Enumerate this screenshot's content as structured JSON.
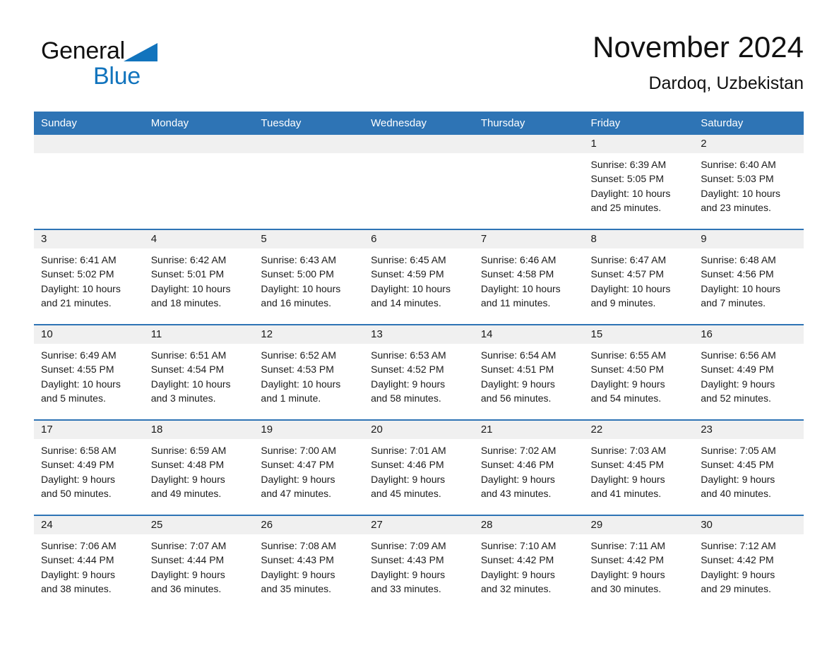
{
  "brand": {
    "name_part1": "General",
    "name_part2": "Blue",
    "triangle_color": "#1274bd",
    "text_color": "#111111"
  },
  "header": {
    "title": "November 2024",
    "subtitle": "Dardoq, Uzbekistan"
  },
  "theme": {
    "header_blue": "#2e74b5",
    "daynum_band": "#f0f0f0",
    "page_background": "#ffffff"
  },
  "weekday_headers": [
    "Sunday",
    "Monday",
    "Tuesday",
    "Wednesday",
    "Thursday",
    "Friday",
    "Saturday"
  ],
  "labels": {
    "sunrise_prefix": "Sunrise:",
    "sunset_prefix": "Sunset:",
    "daylight_prefix": "Daylight:"
  },
  "weeks": [
    [
      {
        "day": "",
        "empty": true
      },
      {
        "day": "",
        "empty": true
      },
      {
        "day": "",
        "empty": true
      },
      {
        "day": "",
        "empty": true
      },
      {
        "day": "",
        "empty": true
      },
      {
        "day": "1",
        "sunrise": "Sunrise: 6:39 AM",
        "sunset": "Sunset: 5:05 PM",
        "daylight_line1": "Daylight: 10 hours",
        "daylight_line2": "and 25 minutes."
      },
      {
        "day": "2",
        "sunrise": "Sunrise: 6:40 AM",
        "sunset": "Sunset: 5:03 PM",
        "daylight_line1": "Daylight: 10 hours",
        "daylight_line2": "and 23 minutes."
      }
    ],
    [
      {
        "day": "3",
        "sunrise": "Sunrise: 6:41 AM",
        "sunset": "Sunset: 5:02 PM",
        "daylight_line1": "Daylight: 10 hours",
        "daylight_line2": "and 21 minutes."
      },
      {
        "day": "4",
        "sunrise": "Sunrise: 6:42 AM",
        "sunset": "Sunset: 5:01 PM",
        "daylight_line1": "Daylight: 10 hours",
        "daylight_line2": "and 18 minutes."
      },
      {
        "day": "5",
        "sunrise": "Sunrise: 6:43 AM",
        "sunset": "Sunset: 5:00 PM",
        "daylight_line1": "Daylight: 10 hours",
        "daylight_line2": "and 16 minutes."
      },
      {
        "day": "6",
        "sunrise": "Sunrise: 6:45 AM",
        "sunset": "Sunset: 4:59 PM",
        "daylight_line1": "Daylight: 10 hours",
        "daylight_line2": "and 14 minutes."
      },
      {
        "day": "7",
        "sunrise": "Sunrise: 6:46 AM",
        "sunset": "Sunset: 4:58 PM",
        "daylight_line1": "Daylight: 10 hours",
        "daylight_line2": "and 11 minutes."
      },
      {
        "day": "8",
        "sunrise": "Sunrise: 6:47 AM",
        "sunset": "Sunset: 4:57 PM",
        "daylight_line1": "Daylight: 10 hours",
        "daylight_line2": "and 9 minutes."
      },
      {
        "day": "9",
        "sunrise": "Sunrise: 6:48 AM",
        "sunset": "Sunset: 4:56 PM",
        "daylight_line1": "Daylight: 10 hours",
        "daylight_line2": "and 7 minutes."
      }
    ],
    [
      {
        "day": "10",
        "sunrise": "Sunrise: 6:49 AM",
        "sunset": "Sunset: 4:55 PM",
        "daylight_line1": "Daylight: 10 hours",
        "daylight_line2": "and 5 minutes."
      },
      {
        "day": "11",
        "sunrise": "Sunrise: 6:51 AM",
        "sunset": "Sunset: 4:54 PM",
        "daylight_line1": "Daylight: 10 hours",
        "daylight_line2": "and 3 minutes."
      },
      {
        "day": "12",
        "sunrise": "Sunrise: 6:52 AM",
        "sunset": "Sunset: 4:53 PM",
        "daylight_line1": "Daylight: 10 hours",
        "daylight_line2": "and 1 minute."
      },
      {
        "day": "13",
        "sunrise": "Sunrise: 6:53 AM",
        "sunset": "Sunset: 4:52 PM",
        "daylight_line1": "Daylight: 9 hours",
        "daylight_line2": "and 58 minutes."
      },
      {
        "day": "14",
        "sunrise": "Sunrise: 6:54 AM",
        "sunset": "Sunset: 4:51 PM",
        "daylight_line1": "Daylight: 9 hours",
        "daylight_line2": "and 56 minutes."
      },
      {
        "day": "15",
        "sunrise": "Sunrise: 6:55 AM",
        "sunset": "Sunset: 4:50 PM",
        "daylight_line1": "Daylight: 9 hours",
        "daylight_line2": "and 54 minutes."
      },
      {
        "day": "16",
        "sunrise": "Sunrise: 6:56 AM",
        "sunset": "Sunset: 4:49 PM",
        "daylight_line1": "Daylight: 9 hours",
        "daylight_line2": "and 52 minutes."
      }
    ],
    [
      {
        "day": "17",
        "sunrise": "Sunrise: 6:58 AM",
        "sunset": "Sunset: 4:49 PM",
        "daylight_line1": "Daylight: 9 hours",
        "daylight_line2": "and 50 minutes."
      },
      {
        "day": "18",
        "sunrise": "Sunrise: 6:59 AM",
        "sunset": "Sunset: 4:48 PM",
        "daylight_line1": "Daylight: 9 hours",
        "daylight_line2": "and 49 minutes."
      },
      {
        "day": "19",
        "sunrise": "Sunrise: 7:00 AM",
        "sunset": "Sunset: 4:47 PM",
        "daylight_line1": "Daylight: 9 hours",
        "daylight_line2": "and 47 minutes."
      },
      {
        "day": "20",
        "sunrise": "Sunrise: 7:01 AM",
        "sunset": "Sunset: 4:46 PM",
        "daylight_line1": "Daylight: 9 hours",
        "daylight_line2": "and 45 minutes."
      },
      {
        "day": "21",
        "sunrise": "Sunrise: 7:02 AM",
        "sunset": "Sunset: 4:46 PM",
        "daylight_line1": "Daylight: 9 hours",
        "daylight_line2": "and 43 minutes."
      },
      {
        "day": "22",
        "sunrise": "Sunrise: 7:03 AM",
        "sunset": "Sunset: 4:45 PM",
        "daylight_line1": "Daylight: 9 hours",
        "daylight_line2": "and 41 minutes."
      },
      {
        "day": "23",
        "sunrise": "Sunrise: 7:05 AM",
        "sunset": "Sunset: 4:45 PM",
        "daylight_line1": "Daylight: 9 hours",
        "daylight_line2": "and 40 minutes."
      }
    ],
    [
      {
        "day": "24",
        "sunrise": "Sunrise: 7:06 AM",
        "sunset": "Sunset: 4:44 PM",
        "daylight_line1": "Daylight: 9 hours",
        "daylight_line2": "and 38 minutes."
      },
      {
        "day": "25",
        "sunrise": "Sunrise: 7:07 AM",
        "sunset": "Sunset: 4:44 PM",
        "daylight_line1": "Daylight: 9 hours",
        "daylight_line2": "and 36 minutes."
      },
      {
        "day": "26",
        "sunrise": "Sunrise: 7:08 AM",
        "sunset": "Sunset: 4:43 PM",
        "daylight_line1": "Daylight: 9 hours",
        "daylight_line2": "and 35 minutes."
      },
      {
        "day": "27",
        "sunrise": "Sunrise: 7:09 AM",
        "sunset": "Sunset: 4:43 PM",
        "daylight_line1": "Daylight: 9 hours",
        "daylight_line2": "and 33 minutes."
      },
      {
        "day": "28",
        "sunrise": "Sunrise: 7:10 AM",
        "sunset": "Sunset: 4:42 PM",
        "daylight_line1": "Daylight: 9 hours",
        "daylight_line2": "and 32 minutes."
      },
      {
        "day": "29",
        "sunrise": "Sunrise: 7:11 AM",
        "sunset": "Sunset: 4:42 PM",
        "daylight_line1": "Daylight: 9 hours",
        "daylight_line2": "and 30 minutes."
      },
      {
        "day": "30",
        "sunrise": "Sunrise: 7:12 AM",
        "sunset": "Sunset: 4:42 PM",
        "daylight_line1": "Daylight: 9 hours",
        "daylight_line2": "and 29 minutes."
      }
    ]
  ]
}
